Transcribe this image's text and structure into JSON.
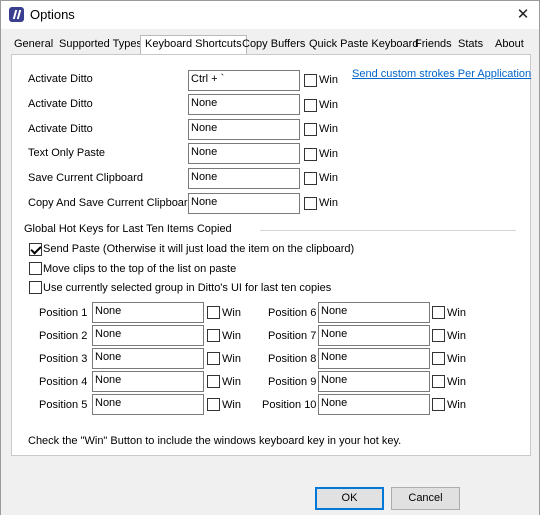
{
  "window": {
    "title": "Options",
    "close": "✕"
  },
  "tabs": [
    {
      "label": "General"
    },
    {
      "label": "Supported Types"
    },
    {
      "label": "Keyboard Shortcuts"
    },
    {
      "label": "Copy Buffers"
    },
    {
      "label": "Quick Paste Keyboard"
    },
    {
      "label": "Friends"
    },
    {
      "label": "Stats"
    },
    {
      "label": "About"
    }
  ],
  "shortcuts": [
    {
      "label": "Activate Ditto",
      "value": "Ctrl + `",
      "win": "Win",
      "win_checked": false
    },
    {
      "label": "Activate Ditto",
      "value": "None",
      "win": "Win",
      "win_checked": false
    },
    {
      "label": "Activate Ditto",
      "value": "None",
      "win": "Win",
      "win_checked": false
    },
    {
      "label": "Text Only Paste",
      "value": "None",
      "win": "Win",
      "win_checked": false
    },
    {
      "label": "Save Current Clipboard",
      "value": "None",
      "win": "Win",
      "win_checked": false
    },
    {
      "label": "Copy And Save Current Clipboard",
      "value": "None",
      "win": "Win",
      "win_checked": false
    }
  ],
  "custom_strokes_link": "Send custom strokes Per Application",
  "global_hotkeys": {
    "heading": "Global Hot Keys for Last Ten Items Copied",
    "options": [
      {
        "label": "Send Paste (Otherwise it will just load the item on the clipboard)",
        "checked": true
      },
      {
        "label": "Move clips to the top of the list on paste",
        "checked": false
      },
      {
        "label": "Use currently selected group in Ditto's UI for last ten copies",
        "checked": false
      }
    ],
    "positions": [
      {
        "label": "Position 1",
        "value": "None",
        "win": "Win"
      },
      {
        "label": "Position 2",
        "value": "None",
        "win": "Win"
      },
      {
        "label": "Position 3",
        "value": "None",
        "win": "Win"
      },
      {
        "label": "Position 4",
        "value": "None",
        "win": "Win"
      },
      {
        "label": "Position 5",
        "value": "None",
        "win": "Win"
      },
      {
        "label": "Position 6",
        "value": "None",
        "win": "Win"
      },
      {
        "label": "Position 7",
        "value": "None",
        "win": "Win"
      },
      {
        "label": "Position 8",
        "value": "None",
        "win": "Win"
      },
      {
        "label": "Position 9",
        "value": "None",
        "win": "Win"
      },
      {
        "label": "Position 10",
        "value": "None",
        "win": "Win"
      }
    ]
  },
  "hint": "Check the \"Win\" Button to include the windows keyboard key in your hot key.",
  "footer": {
    "ok": "OK",
    "cancel": "Cancel"
  }
}
